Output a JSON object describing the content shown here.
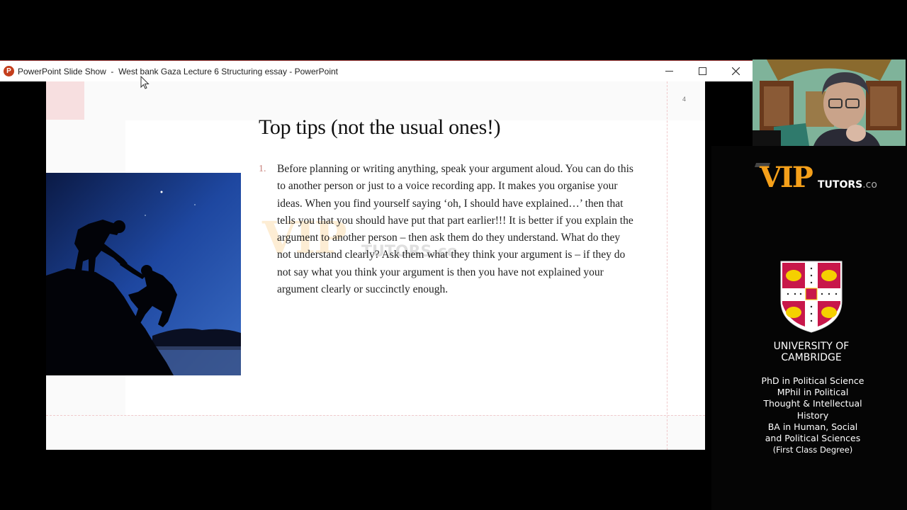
{
  "window": {
    "app_icon_letter": "P",
    "title": "PowerPoint Slide Show  -  West bank Gaza Lecture 6 Structuring essay - PowerPoint",
    "controls": {
      "minimize": "minimize",
      "maximize": "maximize",
      "close": "close"
    }
  },
  "slide": {
    "number": "4",
    "title": "Top tips (not the usual ones!)",
    "tips": [
      {
        "num": "1.",
        "text": "Before planning or writing anything, speak your argument aloud. You can do this to another person or just to a voice recording app. It makes you organise your ideas. When you find yourself saying ‘oh, I should have explained…’  then that tells you that you should have put that part earlier!!! It is better if you explain the argument to another person – then ask them do they understand. What do they not understand clearly? Ask them what they think your argument is – if they do not say what you think your argument is then you have not explained your argument clearly or succinctly enough."
      }
    ],
    "image_alt": "Silhouette of one climber helping another up a rock at night",
    "watermark": {
      "vip": "VIP",
      "tutors": "TUTORS.co"
    }
  },
  "sidebar": {
    "logo": {
      "vip": "VIP",
      "tutors": "TUTORS",
      "domain": ".co"
    },
    "university": {
      "line1": "UNIVERSITY OF",
      "line2": "CAMBRIDGE"
    },
    "degrees": [
      "PhD in Political Science",
      "MPhil in Political",
      "Thought & Intellectual",
      "History",
      "BA in Human, Social",
      "and Political Sciences",
      "(First Class Degree)"
    ]
  },
  "colors": {
    "accent_pink": "#f7dfe0",
    "number_color": "#c9837e",
    "vip_orange": "#f5a01a",
    "cambridge_red": "#c8174a"
  }
}
